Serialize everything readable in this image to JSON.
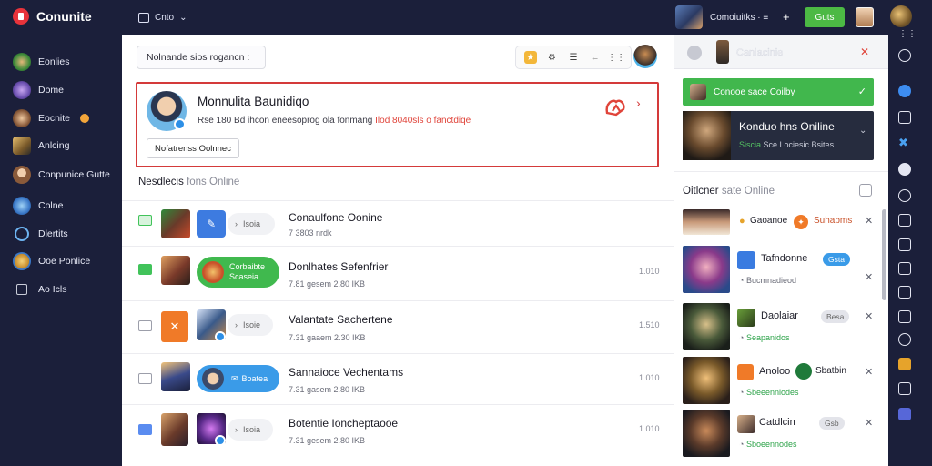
{
  "topbar": {
    "brand": "Conunite",
    "menu_label": "Cnto",
    "user_label": "Comoiuitks · ≡",
    "add_symbol": "+",
    "action_button": "Guts"
  },
  "sidebar": {
    "items": [
      {
        "label": "Eonlies",
        "icon": "game-avatar-icon"
      },
      {
        "label": "Dome",
        "icon": "character-icon"
      },
      {
        "label": "Eocnite",
        "icon": "warrior-icon",
        "badge": true
      },
      {
        "label": "Anlcing",
        "icon": "knight-icon"
      },
      {
        "label": "Conpunice Gutte",
        "icon": "user-avatar-icon"
      },
      {
        "label": "Colne",
        "icon": "globe-icon"
      },
      {
        "label": "Dlertits",
        "icon": "search-icon"
      },
      {
        "label": "Ooe Ponlice",
        "icon": "puzzle-icon"
      },
      {
        "label": "Ao Icls",
        "icon": "window-icon"
      }
    ]
  },
  "main": {
    "search_text": "Nolnande sios rogancn :",
    "toolbar_icons": [
      "star-icon",
      "settings-icon",
      "list-icon",
      "back-icon",
      "grid-icon"
    ],
    "featured": {
      "name": "Monnulita Baunidiqo",
      "desc_pre": "Rse 180 Bd ihcon eneesoprog ola fonmang",
      "desc_highlight": "Ilod 8040sls",
      "desc_post": "o fanctdiqe",
      "button": "Nofatrenss Oolnnec"
    },
    "section_title": "Nesdlecis",
    "section_subtitle": "fons Online",
    "rows": [
      {
        "title": "Conaulfone Oonine",
        "sub": "7 3803 nrdk",
        "time": "",
        "tag_text": "Isoia",
        "check": "green-outline"
      },
      {
        "title": "Donlhates Sefenfrier",
        "sub": "7.81 gesem 2.80 IKB",
        "time": "1.010",
        "tag_text": "Corbaibte",
        "tag_sub": "Scaseia",
        "check": "green"
      },
      {
        "title": "Valantate Sachertene",
        "sub": "7.31 gaaem 2.30 IKB",
        "time": "1.510",
        "tag_text": "Isoie",
        "check": "empty"
      },
      {
        "title": "Sannaioce Vechentams",
        "sub": "7.31 gasem 2.80 IKB",
        "time": "1.010",
        "tag_text": "Boatea",
        "check": "empty"
      },
      {
        "title": "Botentie Ioncheptaooe",
        "sub": "7.31 gesem 2.80 IKB",
        "time": "1.010",
        "tag_text": "Isoia",
        "check": "blue"
      }
    ]
  },
  "right_panel": {
    "header_title": "Canlacinie",
    "green_bar": "Conooe sace Coilby",
    "dark_card": {
      "title": "Konduo hns Oniline",
      "sub_green": "Siscia",
      "sub_rest": "Sce Lociesic Bsites"
    },
    "section_title": "Oitlcner",
    "section_subtitle": "sate Online",
    "list": [
      {
        "name": "Gaoanoe",
        "right": "Suhabms",
        "sub": ""
      },
      {
        "name": "Tafndonne",
        "pill": "Gsta",
        "sub": "Bucmnadieod"
      },
      {
        "name": "Daolaiar",
        "pill": "Besa",
        "sub": "Seapanidos"
      },
      {
        "name": "Anoloo",
        "right": "Sbatbin",
        "sub": "Sbeeenniodes"
      },
      {
        "name": "Catdlcin",
        "pill": "Gsb",
        "sub": "Sboeennodes"
      }
    ]
  },
  "rail_icons": [
    "ellipsis-icon",
    "refresh-icon",
    "chat-icon",
    "shuffle-icon",
    "help-icon",
    "moon-icon",
    "mail-icon",
    "table-icon",
    "image-icon",
    "folder-icon",
    "book-icon",
    "tag-icon",
    "note-icon",
    "window-icon",
    "plus-icon"
  ]
}
